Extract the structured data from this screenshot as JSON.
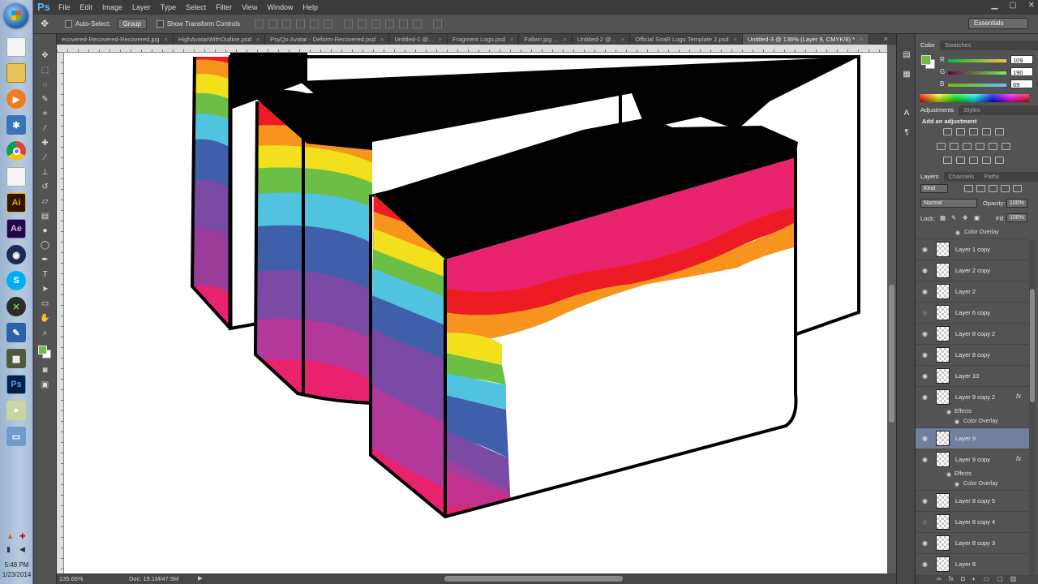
{
  "taskbar": {
    "icons": [
      "start-orb",
      "file-icon",
      "folder-icon",
      "media-player-icon",
      "network-icon",
      "chrome-icon",
      "file-icon",
      "illustrator-icon",
      "after-effects-icon",
      "cinema4d-icon",
      "skype-icon",
      "xbox-icon",
      "tool-icon",
      "file-icon",
      "photoshop-icon",
      "firefox-icon",
      "monitor-icon"
    ],
    "ai_label": "Ai",
    "ae_label": "Ae",
    "ps_label": "Ps",
    "time": "5:48 PM",
    "date": "1/23/2014"
  },
  "app": {
    "logo": "Ps"
  },
  "menu": [
    "File",
    "Edit",
    "Image",
    "Layer",
    "Type",
    "Select",
    "Filter",
    "View",
    "Window",
    "Help"
  ],
  "options": {
    "auto_select_label": "Auto-Select:",
    "auto_select_value": "Group",
    "transform_label": "Show Transform Controls",
    "workspace": "Essentials"
  },
  "doc_tabs": [
    {
      "label": "ecovered-Recovered-Recovered.jpg",
      "active": false
    },
    {
      "label": "HighAvatarWithOutline.psd",
      "active": false
    },
    {
      "label": "PsyQo Avatar - Deform-Recovered.psd",
      "active": false
    },
    {
      "label": "Untitled-1 @...",
      "active": false
    },
    {
      "label": "Fragment Logo.psd",
      "active": false
    },
    {
      "label": "Fallwn.jpg ...",
      "active": false
    },
    {
      "label": "Untitled-2 @...",
      "active": false
    },
    {
      "label": "Official SoaR Logo Template 2.psd",
      "active": false
    },
    {
      "label": "Untitled-3 @ 136% (Layer 9, CMYK/8) *",
      "active": true
    }
  ],
  "status": {
    "zoom": "135.66%",
    "doc": "Doc: 19.1M/47.9M"
  },
  "color_panel": {
    "tabs": [
      "Color",
      "Swatches"
    ],
    "r_label": "R",
    "r": "109",
    "g_label": "G",
    "g": "190",
    "b_label": "B",
    "b": "69",
    "fg_color": "#6dbe45"
  },
  "adjustments": {
    "tabs": [
      "Adjustments",
      "Styles"
    ],
    "title": "Add an adjustment"
  },
  "layers": {
    "tabs": [
      "Layers",
      "Channels",
      "Paths"
    ],
    "kind": "Kind",
    "blend_mode": "Normal",
    "opacity_label": "Opacity:",
    "opacity": "100%",
    "lock_label": "Lock:",
    "fill_label": "Fill:",
    "fill": "100%",
    "top_effect": "Color Overlay",
    "items": [
      {
        "name": "Layer 1 copy",
        "visible": true,
        "fx": false,
        "selected": false
      },
      {
        "name": "Layer 2 copy",
        "visible": true,
        "fx": false,
        "selected": false
      },
      {
        "name": "Layer 2",
        "visible": true,
        "fx": false,
        "selected": false
      },
      {
        "name": "Layer 6 copy",
        "visible": false,
        "fx": false,
        "selected": false
      },
      {
        "name": "Layer 8 copy 2",
        "visible": true,
        "fx": false,
        "selected": false
      },
      {
        "name": "Layer 8 copy",
        "visible": true,
        "fx": false,
        "selected": false
      },
      {
        "name": "Layer 10",
        "visible": true,
        "fx": false,
        "selected": false
      },
      {
        "name": "Layer 9 copy 2",
        "visible": true,
        "fx": true,
        "selected": false
      },
      {
        "name": "Layer 9",
        "visible": true,
        "fx": false,
        "selected": true
      },
      {
        "name": "Layer 9 copy",
        "visible": true,
        "fx": true,
        "selected": false
      },
      {
        "name": "Layer 8 copy 5",
        "visible": true,
        "fx": false,
        "selected": false
      },
      {
        "name": "Layer 8 copy 4",
        "visible": false,
        "fx": false,
        "selected": false
      },
      {
        "name": "Layer 8 copy 3",
        "visible": true,
        "fx": false,
        "selected": false
      },
      {
        "name": "Layer 8",
        "visible": true,
        "fx": false,
        "selected": false
      }
    ],
    "effects_label": "Effects",
    "color_overlay_label": "Color Overlay",
    "fx_label": "fx"
  }
}
